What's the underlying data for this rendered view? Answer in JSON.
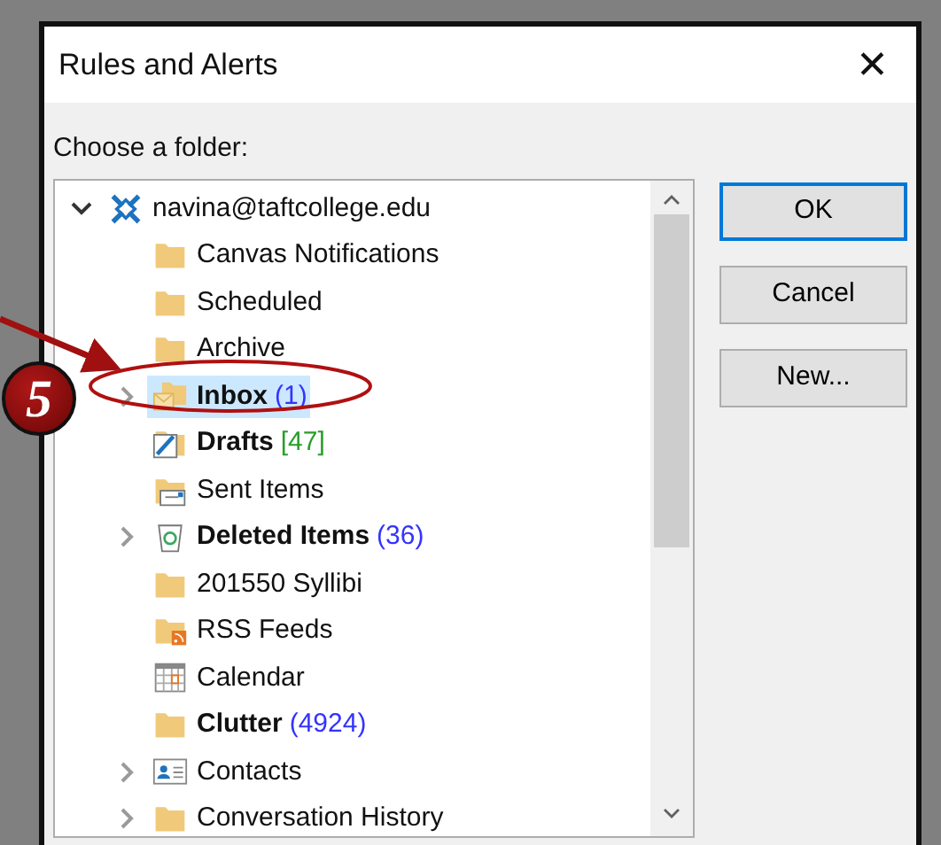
{
  "window": {
    "title": "Rules and Alerts",
    "close": "✕"
  },
  "prompt": "Choose a folder:",
  "tree": {
    "label": "navina@taftcollege.edu",
    "kind": "account",
    "expanded": true,
    "selected": false,
    "children": [
      {
        "label": "Canvas Notifications",
        "kind": "folder",
        "bold": false,
        "selected": false
      },
      {
        "label": "Scheduled",
        "kind": "folder",
        "bold": false,
        "selected": false
      },
      {
        "label": "Archive",
        "kind": "folder",
        "bold": false,
        "selected": false
      },
      {
        "label": "Inbox",
        "count": "(1)",
        "color": "#3333ff",
        "kind": "inbox",
        "bold": true,
        "expanded": false,
        "selected": true
      },
      {
        "label": "Drafts",
        "count": "[47]",
        "color": "#2a9d2a",
        "kind": "drafts",
        "bold": true,
        "selected": false
      },
      {
        "label": "Sent Items",
        "kind": "sent",
        "bold": false,
        "selected": false
      },
      {
        "label": "Deleted Items",
        "count": "(36)",
        "color": "#3333ff",
        "kind": "deleted",
        "bold": true,
        "expanded": false,
        "selected": false
      },
      {
        "label": "201550 Syllibi",
        "kind": "folder",
        "bold": false,
        "selected": false
      },
      {
        "label": "RSS Feeds",
        "kind": "rss",
        "bold": false,
        "selected": false
      },
      {
        "label": "Calendar",
        "kind": "calendar",
        "bold": false,
        "selected": false
      },
      {
        "label": "Clutter",
        "count": "(4924)",
        "color": "#3333ff",
        "kind": "folder",
        "bold": true,
        "selected": false
      },
      {
        "label": "Contacts",
        "kind": "contacts",
        "bold": false,
        "expanded": false,
        "selected": false
      },
      {
        "label": "Conversation History",
        "kind": "folder",
        "bold": false,
        "expanded": false,
        "selected": false
      }
    ]
  },
  "buttons": [
    {
      "label": "OK",
      "default": true
    },
    {
      "label": "Cancel",
      "default": false
    },
    {
      "label": "New...",
      "default": false
    }
  ],
  "annotation": {
    "step": "5"
  }
}
